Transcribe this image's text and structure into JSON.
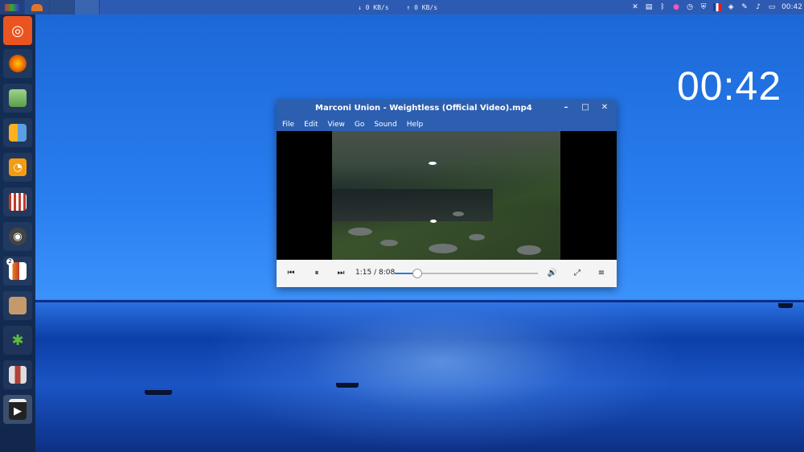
{
  "top_panel": {
    "net_down": "↓ 0 KB/s",
    "net_up": "↑ 0 KB/s",
    "clock": "00:42",
    "tray_icons": [
      "close-icon",
      "filmstrip-icon",
      "bluetooth-icon",
      "chat-icon",
      "alarm-icon",
      "shield-icon",
      "flag-fr-icon",
      "dropbox-icon",
      "pen-icon",
      "music-icon",
      "battery-icon"
    ]
  },
  "desktop": {
    "clock": "00:42"
  },
  "launcher": {
    "items": [
      {
        "name": "ubuntu-dash-icon",
        "glyph": "◎",
        "color": "#e95420"
      },
      {
        "name": "firefox-icon",
        "glyph": "●",
        "color": "#e66000"
      },
      {
        "name": "files-icon",
        "glyph": "▬",
        "color": "#8fbf7a"
      },
      {
        "name": "office-icon",
        "glyph": "▦",
        "color": "#ffb020"
      },
      {
        "name": "rss-icon",
        "glyph": "◔",
        "color": "#f39c12"
      },
      {
        "name": "popcorn-icon",
        "glyph": "▼",
        "color": "#c0392b"
      },
      {
        "name": "camera-icon",
        "glyph": "◉",
        "color": "#555"
      },
      {
        "name": "monitor-icon",
        "glyph": "▮",
        "color": "#e67e22",
        "badge": "2"
      },
      {
        "name": "archive-icon",
        "glyph": "■",
        "color": "#c49a6c"
      },
      {
        "name": "cannabis-icon",
        "glyph": "✱",
        "color": "#4caf50"
      },
      {
        "name": "suit-icon",
        "glyph": "▾",
        "color": "#b0403a"
      },
      {
        "name": "clapper-icon",
        "glyph": "▶",
        "color": "#333"
      }
    ]
  },
  "player": {
    "title": "Marconi Union - Weightless (Official Video).mp4",
    "menu": [
      "File",
      "Edit",
      "View",
      "Go",
      "Sound",
      "Help"
    ],
    "time_label": "1:15 / 8:08",
    "progress": 0.154,
    "accent": "#2c7ad6"
  }
}
